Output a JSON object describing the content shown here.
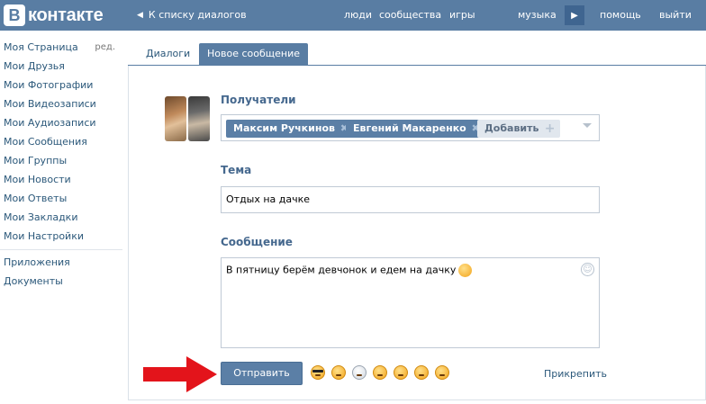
{
  "header": {
    "logo_letter": "В",
    "logo_text": "контакте",
    "back_link": "К списку диалогов",
    "nav": {
      "people": "люди",
      "communities": "сообщества",
      "games": "игры",
      "music": "музыка",
      "help": "помощь",
      "logout": "выйти"
    }
  },
  "sidebar": {
    "items": [
      {
        "label": "Моя Страница",
        "extra": "ред."
      },
      {
        "label": "Мои Друзья"
      },
      {
        "label": "Мои Фотографии"
      },
      {
        "label": "Мои Видеозаписи"
      },
      {
        "label": "Мои Аудиозаписи"
      },
      {
        "label": "Мои Сообщения"
      },
      {
        "label": "Мои Группы"
      },
      {
        "label": "Мои Новости"
      },
      {
        "label": "Мои Ответы"
      },
      {
        "label": "Мои Закладки"
      },
      {
        "label": "Мои Настройки"
      }
    ],
    "extra_items": [
      {
        "label": "Приложения"
      },
      {
        "label": "Документы"
      }
    ]
  },
  "tabs": {
    "dialogs": "Диалоги",
    "new_message": "Новое сообщение"
  },
  "form": {
    "recipients_label": "Получатели",
    "recipients": [
      {
        "name": "Максим Ручкинов"
      },
      {
        "name": "Евгений Макаренко"
      }
    ],
    "add_label": "Добавить",
    "subject_label": "Тема",
    "subject_value": "Отдых на дачке",
    "message_label": "Сообщение",
    "message_text": "В пятницу берём девчонок и едем на дачку",
    "send_label": "Отправить",
    "attach_label": "Прикрепить"
  },
  "colors": {
    "header_bg": "#597da3",
    "link": "#2b587a",
    "label": "#45688e",
    "button": "#5b7fa6",
    "arrow": "#e3141b"
  }
}
